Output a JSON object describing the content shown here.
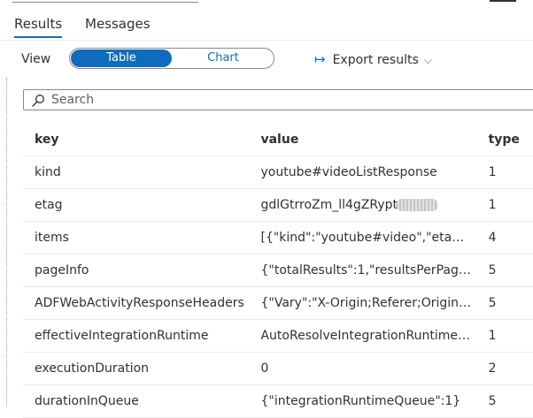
{
  "tabs": {
    "results": "Results",
    "messages": "Messages"
  },
  "view": {
    "label": "View",
    "table": "Table",
    "chart": "Chart"
  },
  "export": {
    "label": "Export results",
    "icon": "export-arrow-icon"
  },
  "search": {
    "placeholder": "Search",
    "icon": "search-icon"
  },
  "table": {
    "headers": {
      "key": "key",
      "value": "value",
      "type": "type"
    },
    "rows": [
      {
        "key": "kind",
        "value": "youtube#videoListResponse",
        "type": "1"
      },
      {
        "key": "etag",
        "value": "gdlGtrroZm_ll4gZRypt",
        "type": "1"
      },
      {
        "key": "items",
        "value": "[{\"kind\":\"youtube#video\",\"etag\":\"...",
        "type": "4"
      },
      {
        "key": "pageInfo",
        "value": "{\"totalResults\":1,\"resultsPerPage\":...",
        "type": "5"
      },
      {
        "key": "ADFWebActivityResponseHeaders",
        "value": "{\"Vary\":\"X-Origin;Referer;Origin;A...",
        "type": "5"
      },
      {
        "key": "effectiveIntegrationRuntime",
        "value": "AutoResolveIntegrationRuntime (...",
        "type": "1"
      },
      {
        "key": "executionDuration",
        "value": "0",
        "type": "2"
      },
      {
        "key": "durationInQueue",
        "value": "{\"integrationRuntimeQueue\":1}",
        "type": "5"
      }
    ]
  },
  "colors": {
    "accent": "#0f6cbd",
    "text": "#323130",
    "border": "#8a8886"
  }
}
